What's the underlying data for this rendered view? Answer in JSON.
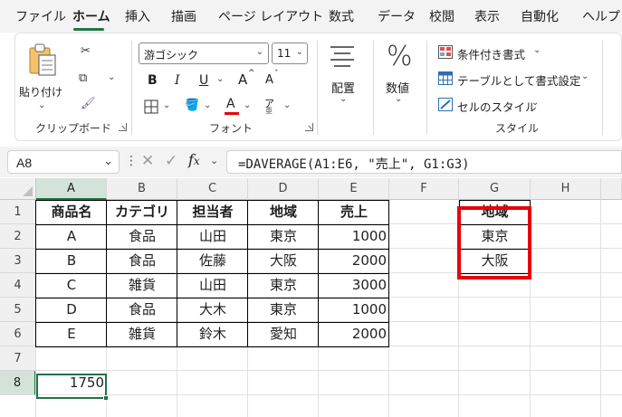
{
  "menu": {
    "tabs": [
      "ファイル",
      "ホーム",
      "挿入",
      "描画",
      "ページ レイアウト",
      "数式",
      "データ",
      "校閲",
      "表示",
      "自動化",
      "ヘルプ"
    ],
    "active_tab": "ホーム"
  },
  "ribbon": {
    "clipboard": {
      "paste_label": "貼り付け",
      "group_label": "クリップボード"
    },
    "font": {
      "font_name": "游ゴシック",
      "font_size": "11",
      "bold": "B",
      "italic": "I",
      "underline": "U",
      "grow": "A",
      "shrink": "A",
      "font_color": "A",
      "phonetic": "ア",
      "group_label": "フォント"
    },
    "alignment": {
      "label": "配置"
    },
    "number": {
      "symbol": "%",
      "label": "数値"
    },
    "styles": {
      "conditional": "条件付き書式",
      "table": "テーブルとして書式設定",
      "cell_styles": "セルのスタイル",
      "group_label": "スタイル"
    }
  },
  "formula_bar": {
    "name_box": "A8",
    "formula": "=DAVERAGE(A1:E6, \"売上\", G1:G3)"
  },
  "grid": {
    "columns": [
      "A",
      "B",
      "C",
      "D",
      "E",
      "F",
      "G",
      "H"
    ],
    "rows": [
      "1",
      "2",
      "3",
      "4",
      "5",
      "6",
      "7",
      "8"
    ],
    "headers": [
      "商品名",
      "カテゴリ",
      "担当者",
      "地域",
      "売上"
    ],
    "records": [
      [
        "A",
        "食品",
        "山田",
        "東京",
        "1000"
      ],
      [
        "B",
        "食品",
        "佐藤",
        "大阪",
        "2000"
      ],
      [
        "C",
        "雑貨",
        "山田",
        "東京",
        "3000"
      ],
      [
        "D",
        "食品",
        "大木",
        "東京",
        "1000"
      ],
      [
        "E",
        "雑貨",
        "鈴木",
        "愛知",
        "2000"
      ]
    ],
    "criteria": {
      "header": "地域",
      "values": [
        "東京",
        "大阪"
      ]
    },
    "result": "1750",
    "selected_cell": "A8"
  },
  "colors": {
    "accent": "#217346",
    "highlight": "#e8000b",
    "font_color_bar": "#e8000b"
  }
}
